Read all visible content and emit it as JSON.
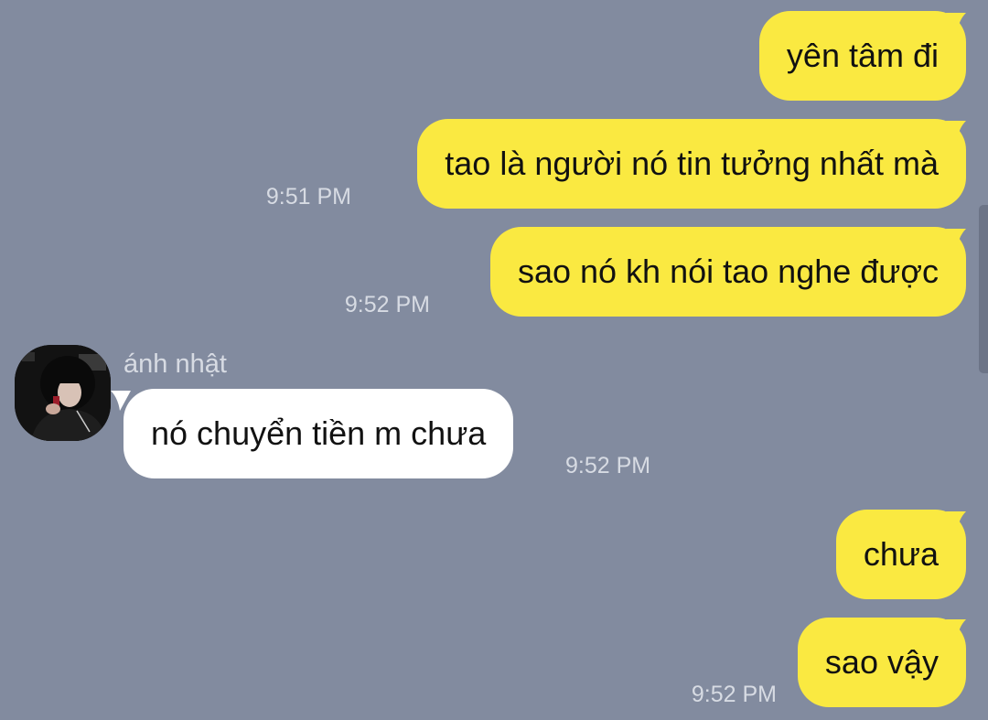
{
  "chat": {
    "background_color": "#828b9f",
    "outgoing_bubble_color": "#fae941",
    "incoming_bubble_color": "#ffffff",
    "messages": [
      {
        "direction": "outgoing",
        "text": "yên tâm đi",
        "time": ""
      },
      {
        "direction": "outgoing",
        "text": "tao là người nó tin tưởng nhất mà",
        "time": "9:51 PM"
      },
      {
        "direction": "outgoing",
        "text": "sao nó kh nói tao nghe được",
        "time": "9:52 PM"
      },
      {
        "direction": "incoming",
        "sender": "ánh nhật",
        "text": "nó chuyển tiền m chưa",
        "time": "9:52 PM"
      },
      {
        "direction": "outgoing",
        "text": "chưa",
        "time": ""
      },
      {
        "direction": "outgoing",
        "text": "sao vậy",
        "time": "9:52 PM"
      }
    ]
  }
}
